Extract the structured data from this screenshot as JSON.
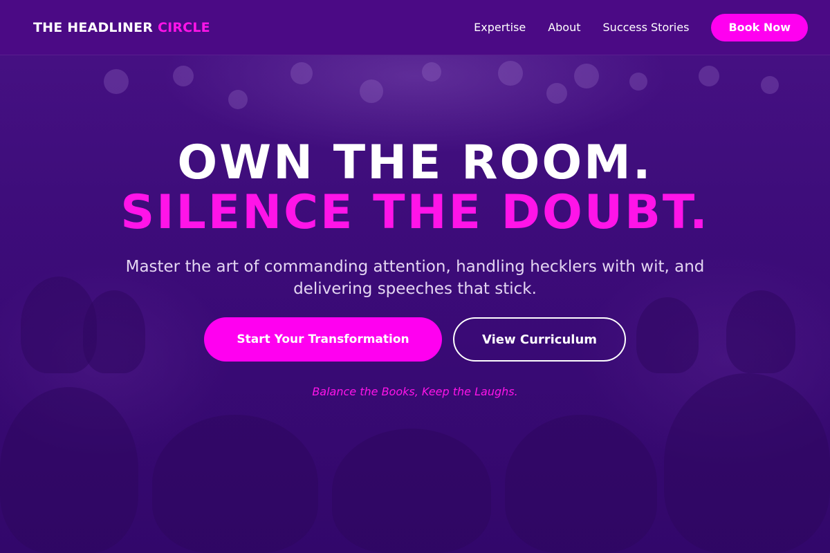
{
  "brand": {
    "name_main": "THE HEADLINER",
    "name_accent": "CIRCLE"
  },
  "nav": {
    "links": [
      "Expertise",
      "About",
      "Success Stories"
    ],
    "cta_label": "Book Now"
  },
  "hero": {
    "headline_line1": "OWN THE ROOM.",
    "headline_line2": "SILENCE THE DOUBT.",
    "subheadline": "Master the art of commanding attention, handling hecklers with wit, and delivering speeches that stick.",
    "primary_cta": "Start Your Transformation",
    "secondary_cta": "View Curriculum",
    "tagline": "Balance the Books, Keep the Laughs."
  },
  "colors": {
    "accent": "#ff00f0",
    "nav_background": "#4b0a85",
    "hero_background": "#3a0a6e",
    "text": "#ffffff"
  }
}
